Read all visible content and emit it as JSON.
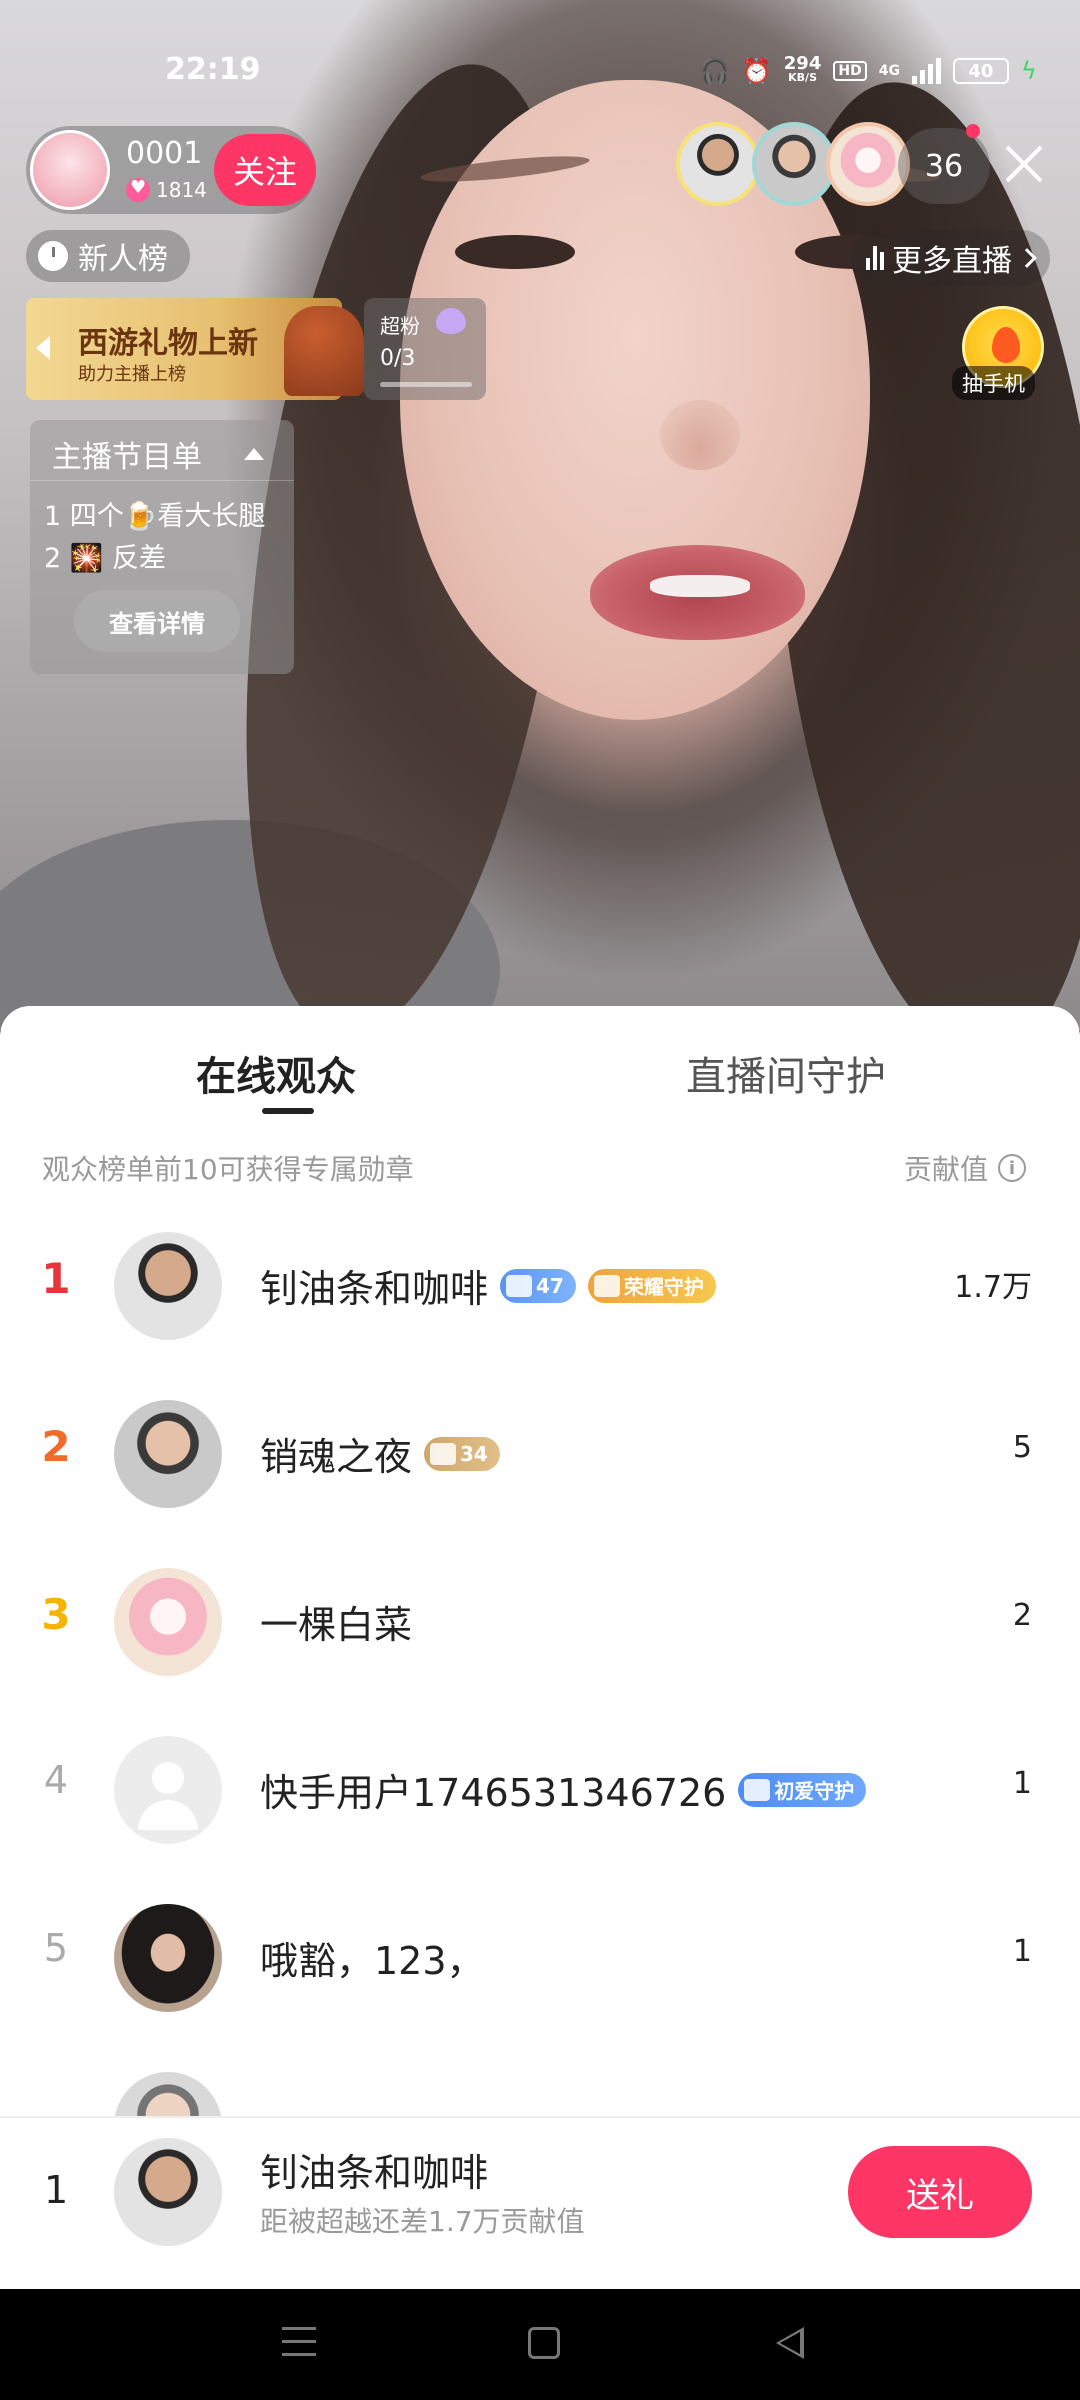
{
  "status_bar": {
    "time": "22:19",
    "net_speed": "294",
    "net_unit": "KB/S",
    "hd": "HD",
    "network": "4G",
    "battery": "40"
  },
  "host": {
    "name": "0001",
    "likes": "1814",
    "follow_label": "关注"
  },
  "viewers": {
    "count": "36"
  },
  "new_rank_label": "新人榜",
  "more_live_label": "更多直播",
  "banner": {
    "title": "西游礼物上新",
    "subtitle": "助力主播上榜"
  },
  "super_fans": {
    "label": "超粉",
    "progress": "0/3"
  },
  "lucky": {
    "label": "抽手机"
  },
  "program": {
    "title": "主播节目单",
    "items": [
      {
        "index": "1",
        "text": "四个🍺看大长腿"
      },
      {
        "index": "2",
        "text": "🎇  反差"
      }
    ],
    "detail_label": "查看详情"
  },
  "sheet": {
    "tabs": [
      "在线观众",
      "直播间守护"
    ],
    "info": "观众榜单前10可获得专属勋章",
    "contribution_label": "贡献值",
    "rows": [
      {
        "rank": "1",
        "name": "钊油条和咖啡",
        "badges": [
          {
            "type": "diamond",
            "text": "47"
          },
          {
            "type": "honor",
            "text": "荣耀守护"
          }
        ],
        "score": "1.7万"
      },
      {
        "rank": "2",
        "name": "销魂之夜",
        "badges": [
          {
            "type": "box",
            "text": "34"
          }
        ],
        "score": "5"
      },
      {
        "rank": "3",
        "name": "一棵白菜",
        "badges": [],
        "score": "2"
      },
      {
        "rank": "4",
        "name": "快手用户1746531346726",
        "badges": [
          {
            "type": "guard",
            "text": "初爱守护"
          }
        ],
        "score": "1"
      },
      {
        "rank": "5",
        "name": "哦豁，123，",
        "badges": [],
        "score": "1"
      }
    ]
  },
  "bottom": {
    "rank": "1",
    "name": "钊油条和咖啡",
    "sub": "距被超越还差1.7万贡献值",
    "gift_label": "送礼"
  },
  "colors": {
    "accent": "#fe3666",
    "rank1": "#e8323c",
    "rank2": "#f36b2a",
    "rank3": "#f5b400"
  }
}
